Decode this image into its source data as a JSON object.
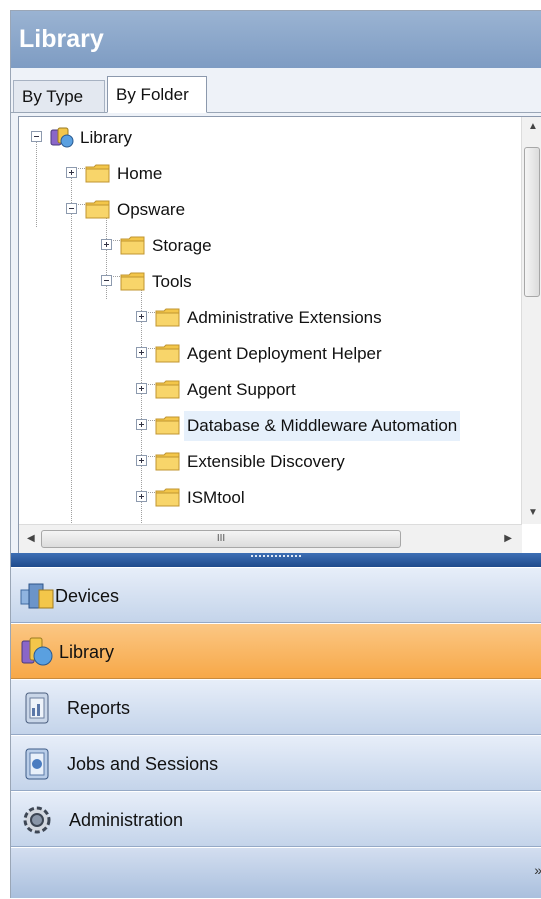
{
  "header": {
    "title": "Library"
  },
  "tabs": [
    {
      "label": "By Type"
    },
    {
      "label": "By Folder"
    }
  ],
  "tree": {
    "nodes": [
      {
        "label": "Library",
        "icon": "library-icon"
      },
      {
        "label": "Home",
        "icon": "folder-icon"
      },
      {
        "label": "Opsware",
        "icon": "folder-icon"
      },
      {
        "label": "Storage",
        "icon": "folder-icon"
      },
      {
        "label": "Tools",
        "icon": "folder-icon"
      },
      {
        "label": "Administrative Extensions",
        "icon": "folder-icon"
      },
      {
        "label": "Agent Deployment Helper",
        "icon": "folder-icon"
      },
      {
        "label": "Agent Support",
        "icon": "folder-icon"
      },
      {
        "label": "Database & Middleware Automation",
        "icon": "folder-icon"
      },
      {
        "label": "Extensible Discovery",
        "icon": "folder-icon"
      },
      {
        "label": "ISMtool",
        "icon": "folder-icon"
      }
    ],
    "hscroll_grip": "III"
  },
  "nav": [
    {
      "label": "Devices",
      "icon": "devices-icon"
    },
    {
      "label": "Library",
      "icon": "library-icon"
    },
    {
      "label": "Reports",
      "icon": "reports-icon"
    },
    {
      "label": "Jobs and Sessions",
      "icon": "jobs-icon"
    },
    {
      "label": "Administration",
      "icon": "administration-icon"
    }
  ],
  "colors": {
    "header": "#8aa6cb",
    "active_nav": "#f8b25a",
    "selection": "#e6f0fb",
    "folder": "#f3c64a"
  }
}
